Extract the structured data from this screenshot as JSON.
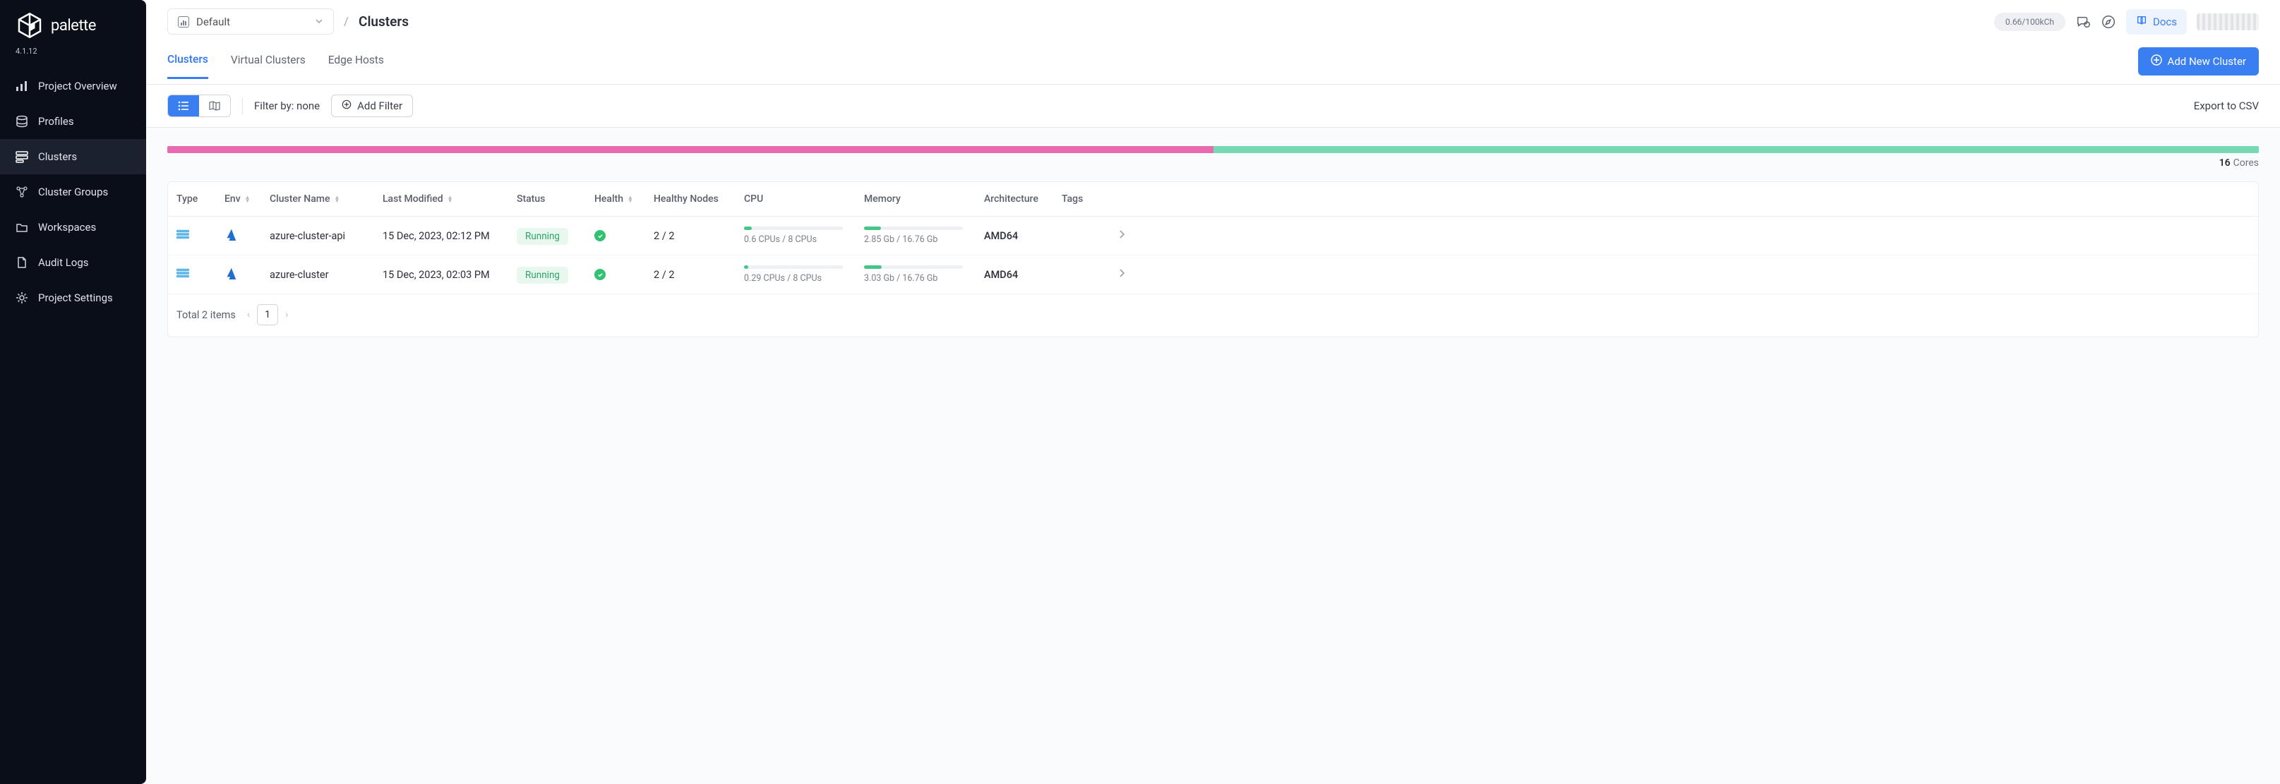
{
  "app": {
    "name": "palette",
    "version": "4.1.12"
  },
  "sidebar": {
    "items": [
      {
        "label": "Project Overview"
      },
      {
        "label": "Profiles"
      },
      {
        "label": "Clusters"
      },
      {
        "label": "Cluster Groups"
      },
      {
        "label": "Workspaces"
      },
      {
        "label": "Audit Logs"
      },
      {
        "label": "Project Settings"
      }
    ]
  },
  "header": {
    "scope": "Default",
    "breadcrumb_current": "Clusters",
    "credits": "0.66/100kCh",
    "docs_label": "Docs"
  },
  "tabs": {
    "items": [
      {
        "label": "Clusters"
      },
      {
        "label": "Virtual Clusters"
      },
      {
        "label": "Edge Hosts"
      }
    ],
    "add_button": "Add New Cluster"
  },
  "filters": {
    "filter_by_prefix": "Filter by: ",
    "filter_by_value": "none",
    "add_filter": "Add Filter",
    "export": "Export to CSV"
  },
  "summary": {
    "band_split_pct": 50,
    "cores_count": "16",
    "cores_label": "Cores"
  },
  "table": {
    "columns": {
      "type": "Type",
      "env": "Env",
      "cluster_name": "Cluster Name",
      "last_modified": "Last Modified",
      "status": "Status",
      "health": "Health",
      "healthy_nodes": "Healthy Nodes",
      "cpu": "CPU",
      "memory": "Memory",
      "architecture": "Architecture",
      "tags": "Tags"
    },
    "rows": [
      {
        "cluster_name": "azure-cluster-api",
        "last_modified": "15 Dec, 2023, 02:12 PM",
        "status": "Running",
        "healthy_nodes": "2 / 2",
        "cpu_text": "0.6 CPUs / 8 CPUs",
        "cpu_pct": 8,
        "memory_text": "2.85 Gb / 16.76 Gb",
        "memory_pct": 17,
        "architecture": "AMD64"
      },
      {
        "cluster_name": "azure-cluster",
        "last_modified": "15 Dec, 2023, 02:03 PM",
        "status": "Running",
        "healthy_nodes": "2 / 2",
        "cpu_text": "0.29 CPUs / 8 CPUs",
        "cpu_pct": 4,
        "memory_text": "3.03 Gb / 16.76 Gb",
        "memory_pct": 18,
        "architecture": "AMD64"
      }
    ],
    "footer": {
      "total": "Total 2 items",
      "page": "1"
    }
  }
}
